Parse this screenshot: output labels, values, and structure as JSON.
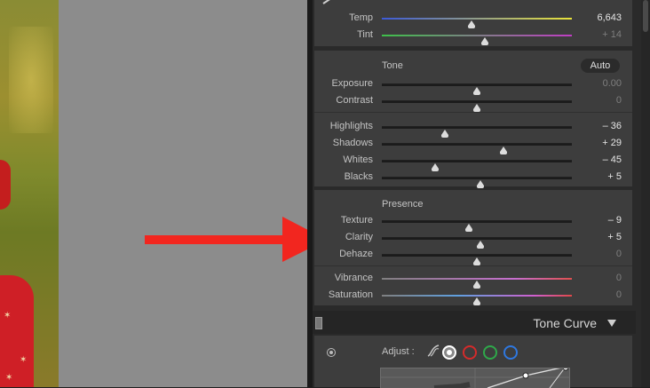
{
  "white_balance": {
    "sliders": [
      {
        "label": "Temp",
        "value": "6,643",
        "dim": false,
        "pos": 0.47,
        "track": "temp"
      },
      {
        "label": "Tint",
        "value": "+ 14",
        "dim": true,
        "pos": 0.54,
        "track": "tint"
      }
    ]
  },
  "tone": {
    "title": "Tone",
    "auto_label": "Auto",
    "sliders": [
      {
        "label": "Exposure",
        "value": "0.00",
        "dim": true,
        "pos": 0.5
      },
      {
        "label": "Contrast",
        "value": "0",
        "dim": true,
        "pos": 0.5
      },
      {
        "label": "Highlights",
        "value": "– 36",
        "dim": false,
        "pos": 0.33
      },
      {
        "label": "Shadows",
        "value": "+ 29",
        "dim": false,
        "pos": 0.64
      },
      {
        "label": "Whites",
        "value": "– 45",
        "dim": false,
        "pos": 0.28
      },
      {
        "label": "Blacks",
        "value": "+ 5",
        "dim": false,
        "pos": 0.52
      }
    ]
  },
  "presence": {
    "title": "Presence",
    "sliders": [
      {
        "label": "Texture",
        "value": "– 9",
        "dim": false,
        "pos": 0.46
      },
      {
        "label": "Clarity",
        "value": "+ 5",
        "dim": false,
        "pos": 0.52
      },
      {
        "label": "Dehaze",
        "value": "0",
        "dim": true,
        "pos": 0.5
      },
      {
        "label": "Vibrance",
        "value": "0",
        "dim": true,
        "pos": 0.5,
        "track": "vib"
      },
      {
        "label": "Saturation",
        "value": "0",
        "dim": true,
        "pos": 0.5,
        "track": "sat"
      }
    ]
  },
  "tone_curve": {
    "title": "Tone Curve",
    "adjust_label": "Adjust :",
    "channel_colors": [
      "#ffffff",
      "#d42b2b",
      "#2fa84a",
      "#2f78e0"
    ]
  },
  "colors": {
    "arrow": "#f2261f",
    "panel_bg": "#3d3d3d"
  },
  "icons": [
    "target-adjust-icon",
    "parametric-curve-icon",
    "disclosure-triangle-icon",
    "panel-switch-icon"
  ]
}
